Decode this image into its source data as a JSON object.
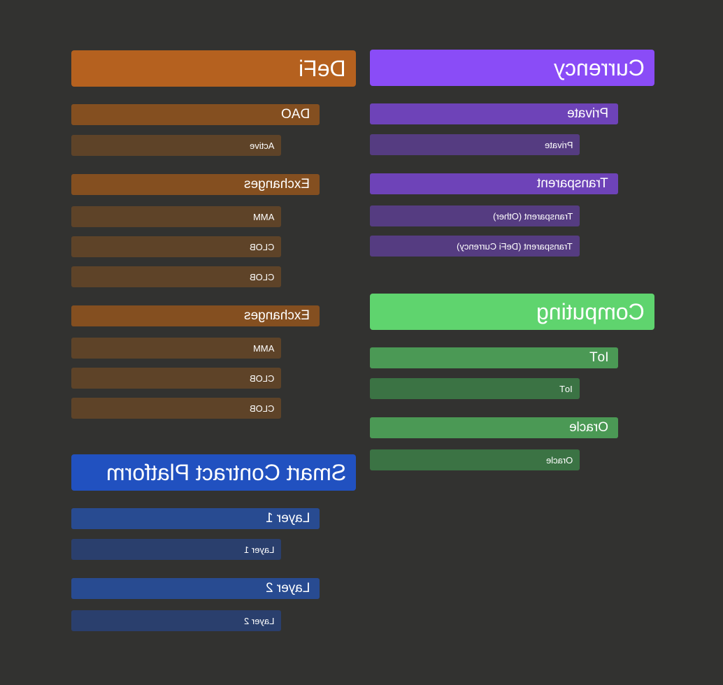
{
  "colors": {
    "background": "#323230",
    "defi": "#b5611f",
    "defi_sub": "#844f20",
    "defi_leaf": "#5e4328",
    "currency": "#8a4cf7",
    "currency_sub": "#6e43b8",
    "currency_leaf": "#553c81",
    "computing": "#5fd46e",
    "computing_sub": "#4b9955",
    "computing_leaf": "#3b7344",
    "smart": "#2151c0",
    "smart_sub": "#284b91",
    "smart_leaf": "#2a3f6d"
  },
  "defi": {
    "title": "DeFi",
    "dao": {
      "label": "DAO",
      "items": [
        "Active"
      ]
    },
    "exchanges_1": {
      "label": "Exchanges",
      "items": [
        "AMM",
        "CLOB",
        "CLOB"
      ]
    },
    "exchanges_2": {
      "label": "Exchanges",
      "items": [
        "AMM",
        "CLOB",
        "CLOB"
      ]
    }
  },
  "smart_contract_platform": {
    "title": "Smart Contract Platform",
    "layer1": {
      "label": "Layer 1",
      "items": [
        "Layer 1"
      ]
    },
    "layer2": {
      "label": "Layer 2",
      "items": [
        "Layer 2"
      ]
    }
  },
  "currency": {
    "title": "Currency",
    "private": {
      "label": "Private",
      "items": [
        "Private"
      ]
    },
    "transparent": {
      "label": "Transparent",
      "items": [
        "Transparent (Other)",
        "Transparent (DeFi Currency)"
      ]
    }
  },
  "computing": {
    "title": "Computing",
    "iot": {
      "label": "IoT",
      "items": [
        "IoT"
      ]
    },
    "oracle": {
      "label": "Oracle",
      "items": [
        "Oracle"
      ]
    }
  }
}
